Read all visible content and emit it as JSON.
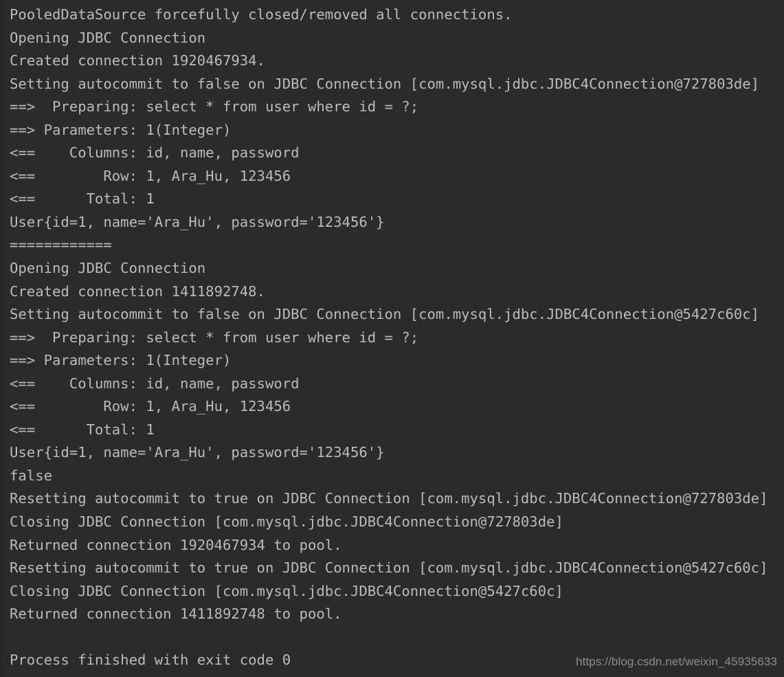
{
  "console": {
    "theme": {
      "background": "#2b2b2b",
      "text_color": "#bbbbbb",
      "watermark_color": "#8d8d8d"
    },
    "lines": [
      "PooledDataSource forcefully closed/removed all connections.",
      "Opening JDBC Connection",
      "Created connection 1920467934.",
      "Setting autocommit to false on JDBC Connection [com.mysql.jdbc.JDBC4Connection@727803de]",
      "==>  Preparing: select * from user where id = ?;",
      "==> Parameters: 1(Integer)",
      "<==    Columns: id, name, password",
      "<==        Row: 1, Ara_Hu, 123456",
      "<==      Total: 1",
      "User{id=1, name='Ara_Hu', password='123456'}",
      "============",
      "Opening JDBC Connection",
      "Created connection 1411892748.",
      "Setting autocommit to false on JDBC Connection [com.mysql.jdbc.JDBC4Connection@5427c60c]",
      "==>  Preparing: select * from user where id = ?;",
      "==> Parameters: 1(Integer)",
      "<==    Columns: id, name, password",
      "<==        Row: 1, Ara_Hu, 123456",
      "<==      Total: 1",
      "User{id=1, name='Ara_Hu', password='123456'}",
      "false",
      "Resetting autocommit to true on JDBC Connection [com.mysql.jdbc.JDBC4Connection@727803de]",
      "Closing JDBC Connection [com.mysql.jdbc.JDBC4Connection@727803de]",
      "Returned connection 1920467934 to pool.",
      "Resetting autocommit to true on JDBC Connection [com.mysql.jdbc.JDBC4Connection@5427c60c]",
      "Closing JDBC Connection [com.mysql.jdbc.JDBC4Connection@5427c60c]",
      "Returned connection 1411892748 to pool.",
      "",
      "Process finished with exit code 0"
    ],
    "exit_code": "0",
    "connection_ids": [
      "1920467934",
      "1411892748"
    ],
    "connection_hashes": [
      "727803de",
      "5427c60c"
    ]
  },
  "watermark": {
    "text": "https://blog.csdn.net/weixin_45935633"
  }
}
